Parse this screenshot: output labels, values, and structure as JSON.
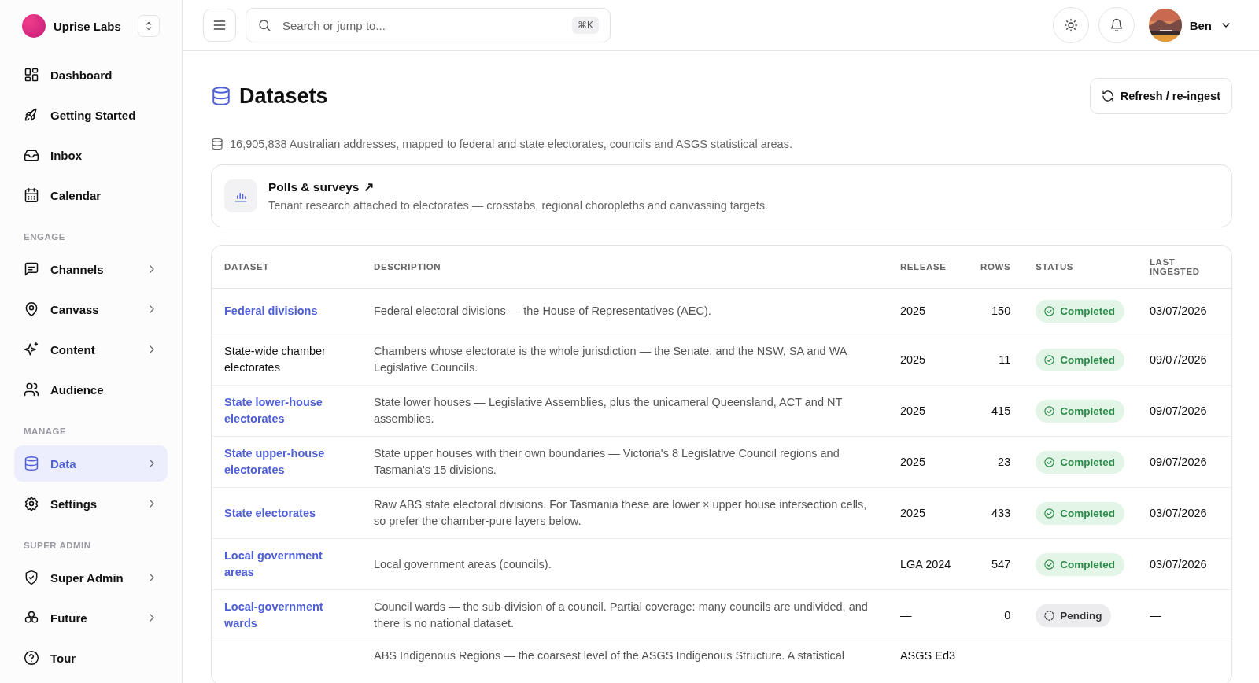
{
  "org": {
    "name": "Uprise Labs"
  },
  "nav": [
    {
      "label": "Dashboard",
      "submenu": false,
      "selected": false
    },
    {
      "label": "Getting Started",
      "submenu": false,
      "selected": false
    },
    {
      "label": "Inbox",
      "submenu": false,
      "selected": false
    },
    {
      "label": "Calendar",
      "submenu": false,
      "selected": false
    },
    {
      "kind": "heading",
      "label": "ENGAGE"
    },
    {
      "label": "Channels",
      "submenu": true,
      "selected": false
    },
    {
      "label": "Canvass",
      "submenu": true,
      "selected": false
    },
    {
      "label": "Content",
      "submenu": true,
      "selected": false
    },
    {
      "label": "Audience",
      "submenu": false,
      "selected": false
    },
    {
      "kind": "heading",
      "label": "MANAGE"
    },
    {
      "label": "Data",
      "submenu": true,
      "selected": true
    },
    {
      "label": "Settings",
      "submenu": true,
      "selected": false
    },
    {
      "kind": "heading",
      "label": "SUPER ADMIN"
    },
    {
      "label": "Super Admin",
      "submenu": true,
      "selected": false
    },
    {
      "label": "Future",
      "submenu": true,
      "selected": false
    },
    {
      "label": "Tour",
      "submenu": false,
      "selected": false
    }
  ],
  "search": {
    "placeholder": "Search or jump to...",
    "shortcut": "⌘K"
  },
  "user": {
    "name": "Ben"
  },
  "page": {
    "title": "Datasets",
    "action": "Refresh / re-ingest",
    "summary": "16,905,838 Australian addresses, mapped to federal and state electorates, councils and ASGS statistical areas."
  },
  "card": {
    "title": "Polls & surveys",
    "arrow": "↗",
    "text": "Tenant research attached to electorates — crosstabs, regional choropleths and canvassing targets."
  },
  "table": {
    "columns": [
      "DATASET",
      "DESCRIPTION",
      "RELEASE",
      "ROWS",
      "STATUS",
      "LAST INGESTED"
    ],
    "rows": [
      {
        "dataset": "Federal divisions",
        "link": true,
        "description": "Federal electoral divisions — the House of Representatives (AEC).",
        "release": "2025",
        "rows": "150",
        "status": "Completed",
        "kind": "completed",
        "last": "03/07/2026"
      },
      {
        "dataset": "State-wide chamber electorates",
        "link": false,
        "description": "Chambers whose electorate is the whole jurisdiction — the Senate, and the NSW, SA and WA Legislative Councils.",
        "release": "2025",
        "rows": "11",
        "status": "Completed",
        "kind": "completed",
        "last": "09/07/2026"
      },
      {
        "dataset": "State lower-house electorates",
        "link": true,
        "description": "State lower houses — Legislative Assemblies, plus the unicameral Queensland, ACT and NT assemblies.",
        "release": "2025",
        "rows": "415",
        "status": "Completed",
        "kind": "completed",
        "last": "09/07/2026"
      },
      {
        "dataset": "State upper-house electorates",
        "link": true,
        "description": "State upper houses with their own boundaries — Victoria's 8 Legislative Council regions and Tasmania's 15 divisions.",
        "release": "2025",
        "rows": "23",
        "status": "Completed",
        "kind": "completed",
        "last": "09/07/2026"
      },
      {
        "dataset": "State electorates",
        "link": true,
        "description": "Raw ABS state electoral divisions. For Tasmania these are lower × upper house intersection cells, so prefer the chamber-pure layers below.",
        "release": "2025",
        "rows": "433",
        "status": "Completed",
        "kind": "completed",
        "last": "03/07/2026"
      },
      {
        "dataset": "Local government areas",
        "link": true,
        "description": "Local government areas (councils).",
        "release": "LGA 2024",
        "rows": "547",
        "status": "Completed",
        "kind": "completed",
        "last": "03/07/2026"
      },
      {
        "dataset": "Local-government wards",
        "link": true,
        "description": "Council wards — the sub-division of a council. Partial coverage: many councils are undivided, and there is no national dataset.",
        "release": "—",
        "rows": "0",
        "status": "Pending",
        "kind": "pending",
        "last": "—"
      },
      {
        "description": "ABS Indigenous Regions — the coarsest level of the ASGS Indigenous Structure. A statistical",
        "release": "ASGS Ed3"
      }
    ]
  }
}
